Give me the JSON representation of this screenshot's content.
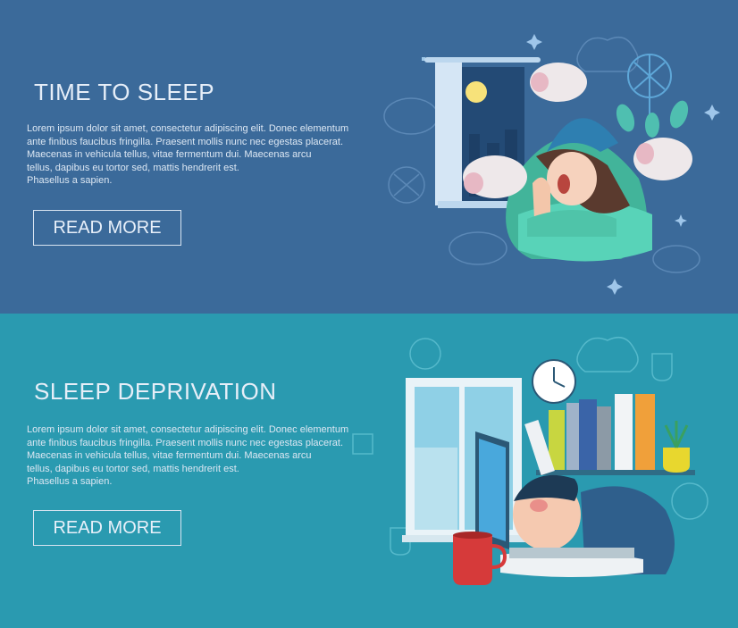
{
  "banners": [
    {
      "title": "TIME TO SLEEP",
      "body": "Lorem ipsum dolor sit amet, consectetur adipiscing elit. Donec elementum\n ante finibus faucibus fringilla. Praesent mollis nunc nec egestas placerat.\nMaecenas in vehicula tellus, vitae fermentum dui. Maecenas arcu\ntellus, dapibus eu tortor sed, mattis hendrerit est.\nPhasellus a sapien.",
      "button_label": "READ MORE"
    },
    {
      "title": "SLEEP DEPRIVATION",
      "body": "Lorem ipsum dolor sit amet, consectetur adipiscing elit. Donec elementum\n ante finibus faucibus fringilla. Praesent mollis nunc nec egestas placerat.\nMaecenas in vehicula tellus, vitae fermentum dui. Maecenas arcu\ntellus, dapibus eu tortor sed, mattis hendrerit est.\nPhasellus a sapien.",
      "button_label": "READ MORE"
    }
  ],
  "colors": {
    "banner1_bg": "#3b6a9a",
    "banner2_bg": "#2a9ab0",
    "text": "#e6eef8"
  }
}
